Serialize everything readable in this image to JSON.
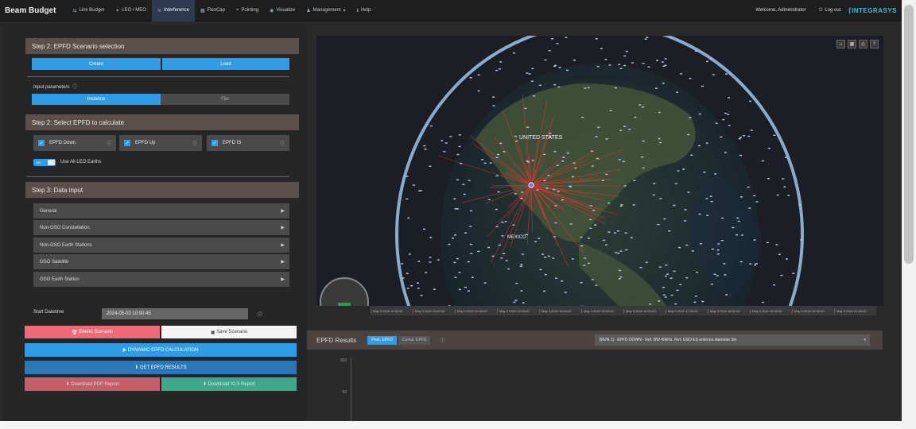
{
  "brand": "Beam Budget",
  "nav": [
    {
      "label": "Link Budget",
      "icon": "link-icon",
      "active": false
    },
    {
      "label": "LEO / MEO",
      "icon": "satellite-icon",
      "active": false
    },
    {
      "label": "Interference",
      "icon": "interference-icon",
      "active": true
    },
    {
      "label": "FlexCap",
      "icon": "chart-icon",
      "active": false
    },
    {
      "label": "Pointing",
      "icon": "pointing-icon",
      "active": false
    },
    {
      "label": "Visualize",
      "icon": "eye-icon",
      "active": false
    },
    {
      "label": "Management",
      "icon": "management-icon",
      "active": false
    },
    {
      "label": "Help",
      "icon": "help-icon",
      "active": false
    }
  ],
  "welcome": "Welcome, Administrator",
  "logout": "Log out",
  "logo": "INTEGRASYS",
  "step2_selection": {
    "title": "Step 2: EPFD Scenario selection",
    "create_label": "Create",
    "load_label": "Load",
    "input_params_label": "Input parameters",
    "instance_label": "Instance",
    "file_label": "File"
  },
  "step2_calc": {
    "title": "Step 2: Select EPFD to calculate",
    "checks": [
      "EPFD Down",
      "EPFD Up",
      "EPFD IS"
    ],
    "toggle_label": "ON",
    "use_all_label": "Use All LEO Earths"
  },
  "step3": {
    "title": "Step 3: Data input",
    "sections": [
      "General",
      "Non-GSO Constellation",
      "Non-GSO Earth Stations",
      "GSO Satellite",
      "GSO Earth Station"
    ]
  },
  "start_datetime": {
    "label": "Start Datetime",
    "value": "2024-05-03 10:00:45"
  },
  "buttons": {
    "delete": "Delete Scenario",
    "save": "Save Scenario",
    "dynamic": "DYNAMIC EPFD CALCULATION",
    "get_results": "GET EPFD RESULTS",
    "download_pdf": "Download PDF Report",
    "download_xls": "Download XLS Report"
  },
  "map": {
    "labels": [
      "UNITED STATES",
      "MEXICO"
    ]
  },
  "timeline": [
    "May 3 2024 10:00:00",
    "May 3 2024 11:00:00",
    "May 3 2024 12:00:00",
    "May 3 2024 13:00:00",
    "May 3 2024 14:00:00",
    "May 3 2024 15:00:00",
    "May 3 2024 16:00:00",
    "May 3 2024 17:00:00",
    "May 3 2024 18:00:00",
    "May 3 2024 19:00:00",
    "May 3 2024 20:00:00",
    "May 3 2024 21:00:00"
  ],
  "results": {
    "title": "EPFD Results",
    "tab_on": "Prob. EPFD",
    "tab_off": "Cumul. EPFD",
    "select_value": "[RUN 1] - EPFD DOWN - Ref. BW 40kHz, Ref. GSO ES antenna diameter 3m"
  },
  "plot": {
    "ticks": [
      "100",
      "50"
    ]
  },
  "colors": {
    "accent": "#2d9de8",
    "step_header": "#5a4f4a",
    "danger": "#f06a78",
    "success": "#3ea889"
  }
}
